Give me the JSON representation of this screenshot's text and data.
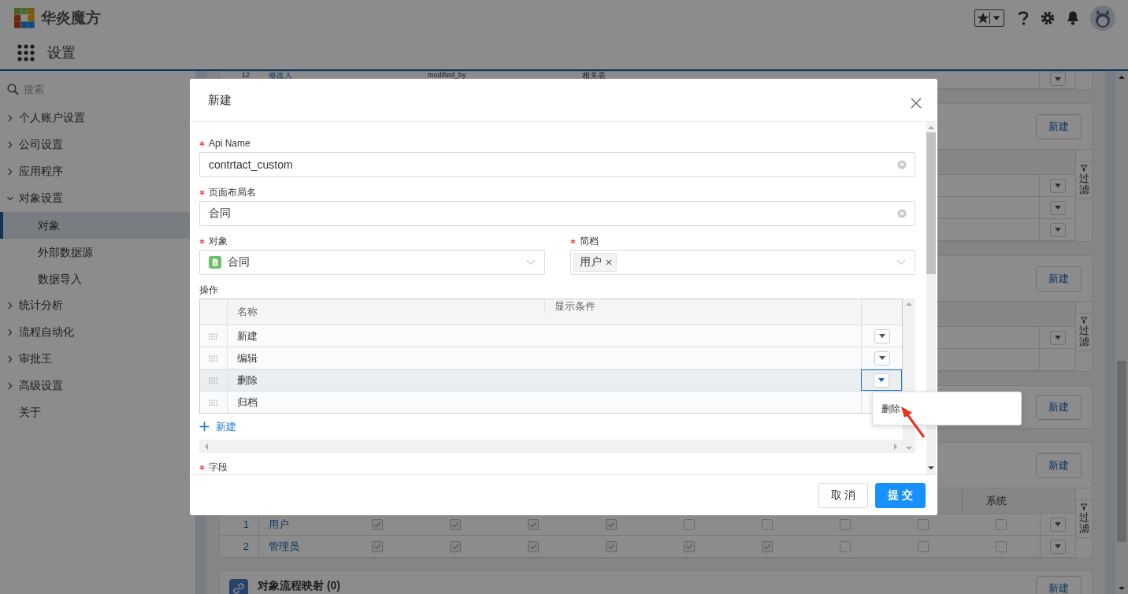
{
  "header": {
    "logo_text": "华炎魔方",
    "app_title": "设置"
  },
  "sidebar": {
    "search_placeholder": "搜索",
    "items": [
      {
        "label": "个人账户设置",
        "expanded": false
      },
      {
        "label": "公司设置",
        "expanded": false
      },
      {
        "label": "应用程序",
        "expanded": false
      },
      {
        "label": "对象设置",
        "expanded": true,
        "children": [
          {
            "label": "对象",
            "selected": true
          },
          {
            "label": "外部数据源",
            "selected": false
          },
          {
            "label": "数据导入",
            "selected": false
          }
        ]
      },
      {
        "label": "统计分析",
        "expanded": false
      },
      {
        "label": "流程自动化",
        "expanded": false
      },
      {
        "label": "审批王",
        "expanded": false
      },
      {
        "label": "高级设置",
        "expanded": false
      },
      {
        "label": "关于"
      }
    ]
  },
  "background_cards": [
    {
      "kind": "table",
      "rows": [
        {
          "kind": "row",
          "cells": [
            "12",
            "修改人",
            "modified_by",
            "相关表"
          ]
        }
      ]
    },
    {
      "kind": "table",
      "new_label": "新建",
      "filter_label": "过滤",
      "rows": [
        {
          "kind": "row"
        },
        {
          "kind": "row"
        },
        {
          "kind": "row"
        }
      ]
    },
    {
      "kind": "table",
      "new_label": "新建",
      "filter_label": "过滤",
      "rows": [
        {
          "kind": "row"
        },
        {
          "kind": "blank"
        }
      ]
    },
    {
      "kind": "head",
      "new_label": "新建"
    },
    {
      "kind": "permissions",
      "new_label": "新建",
      "filter_label": "过滤",
      "last_column": "系统",
      "rows": [
        {
          "number": "1",
          "name": "用户",
          "checks": [
            true,
            true,
            true,
            true,
            false,
            false,
            false,
            false,
            false
          ]
        },
        {
          "number": "2",
          "name": "管理员",
          "checks": [
            true,
            true,
            true,
            true,
            true,
            true,
            false,
            false,
            false
          ]
        }
      ]
    },
    {
      "kind": "flow",
      "title": "对象流程映射 (0)",
      "new_label": "新建"
    }
  ],
  "modal": {
    "title": "新建",
    "fields": [
      {
        "label": "Api Name",
        "required": true,
        "value": "contrtact_custom"
      },
      {
        "label": "页面布局名",
        "required": true,
        "value": "合同"
      }
    ],
    "pair": [
      {
        "kind": "select",
        "label": "对象",
        "required": true,
        "value": "合同"
      },
      {
        "kind": "tags",
        "label": "简档",
        "required": true,
        "tags": [
          "用户"
        ]
      }
    ],
    "operations": {
      "label": "操作",
      "columns": [
        "名称",
        "显示条件"
      ],
      "rows": [
        {
          "name": "新建",
          "selected": false
        },
        {
          "name": "编辑",
          "selected": false
        },
        {
          "name": "删除",
          "selected": true
        },
        {
          "name": "归档",
          "selected": false
        }
      ],
      "add_label": "新建"
    },
    "next_field": {
      "label": "字段",
      "required": true
    },
    "menu": {
      "items": [
        "删除"
      ]
    },
    "buttons": [
      {
        "label": "取 消",
        "kind": "default"
      },
      {
        "label": "提 交",
        "kind": "primary"
      }
    ]
  }
}
